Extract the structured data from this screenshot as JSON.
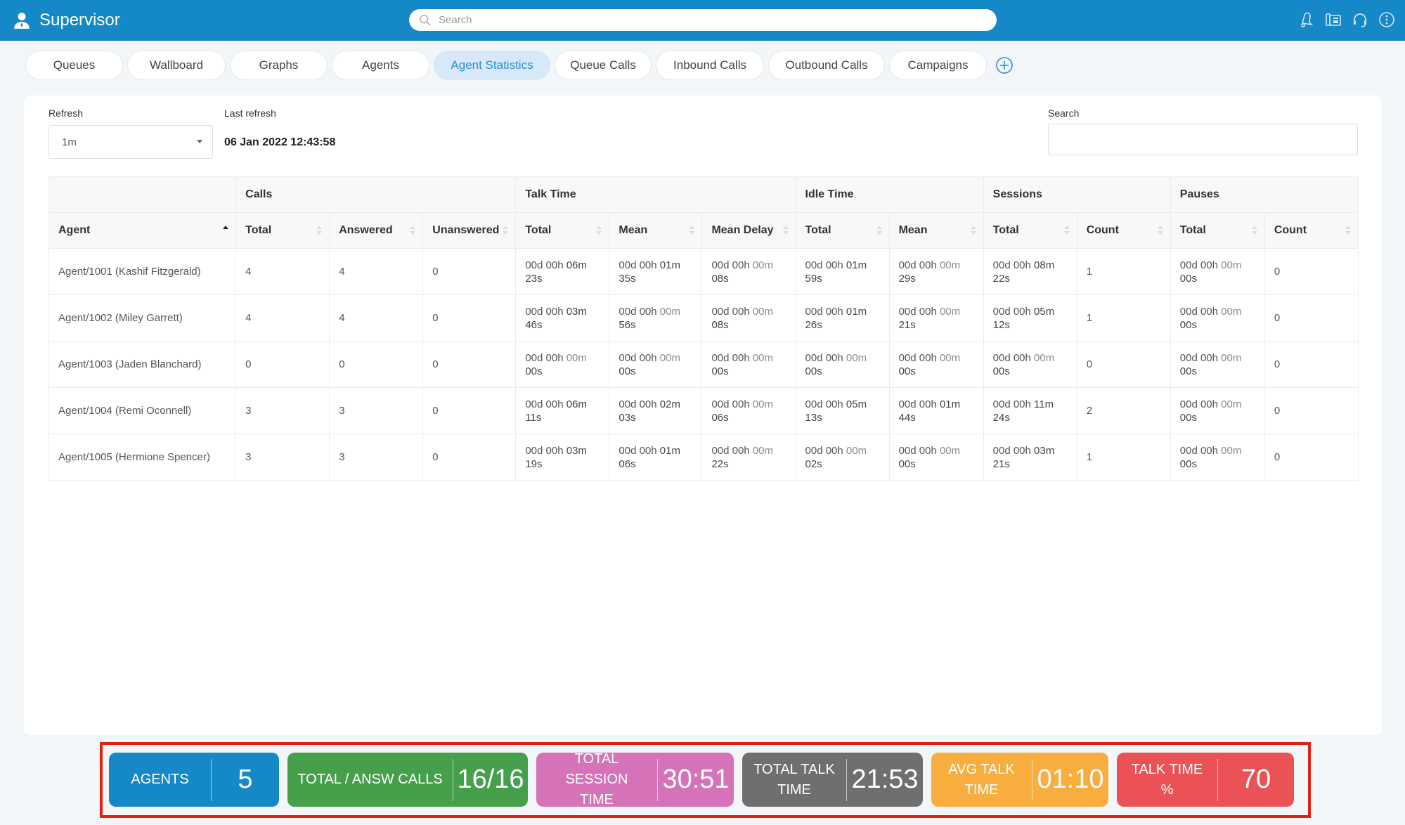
{
  "header": {
    "title": "Supervisor",
    "search_placeholder": "Search",
    "icons": [
      "bell-icon",
      "phone-icon",
      "headset-icon",
      "more-options-icon"
    ]
  },
  "tabs": [
    {
      "label": "Queues",
      "active": false
    },
    {
      "label": "Wallboard",
      "active": false
    },
    {
      "label": "Graphs",
      "active": false
    },
    {
      "label": "Agents",
      "active": false
    },
    {
      "label": "Agent Statistics",
      "active": true
    },
    {
      "label": "Queue Calls",
      "active": false
    },
    {
      "label": "Inbound Calls",
      "active": false
    },
    {
      "label": "Outbound Calls",
      "active": false
    },
    {
      "label": "Campaigns",
      "active": false
    }
  ],
  "controls": {
    "refresh_label": "Refresh",
    "refresh_value": "1m",
    "last_refresh_label": "Last refresh",
    "last_refresh_value": "06 Jan 2022 12:43:58",
    "search_label": "Search",
    "search_value": ""
  },
  "table": {
    "groups": [
      "",
      "Calls",
      "Talk Time",
      "Idle Time",
      "Sessions",
      "Pauses"
    ],
    "columns": [
      "Agent",
      "Total",
      "Answered",
      "Unanswered",
      "Total",
      "Mean",
      "Mean Delay",
      "Total",
      "Mean",
      "Total",
      "Count",
      "Total",
      "Count"
    ],
    "sorted_column": "Agent",
    "sort_direction": "ascending",
    "rows": [
      [
        "Agent/1001 (Kashif Fitzgerald)",
        "4",
        "4",
        "0",
        "00d 00h 06m 23s",
        "00d 00h 01m 35s",
        "00d 00h 00m 08s",
        "00d 00h 01m 59s",
        "00d 00h 00m 29s",
        "00d 00h 08m 22s",
        "1",
        "00d 00h 00m 00s",
        "0"
      ],
      [
        "Agent/1002 (Miley Garrett)",
        "4",
        "4",
        "0",
        "00d 00h 03m 46s",
        "00d 00h 00m 56s",
        "00d 00h 00m 08s",
        "00d 00h 01m 26s",
        "00d 00h 00m 21s",
        "00d 00h 05m 12s",
        "1",
        "00d 00h 00m 00s",
        "0"
      ],
      [
        "Agent/1003 (Jaden Blanchard)",
        "0",
        "0",
        "0",
        "00d 00h 00m 00s",
        "00d 00h 00m 00s",
        "00d 00h 00m 00s",
        "00d 00h 00m 00s",
        "00d 00h 00m 00s",
        "00d 00h 00m 00s",
        "0",
        "00d 00h 00m 00s",
        "0"
      ],
      [
        "Agent/1004 (Remi Oconnell)",
        "3",
        "3",
        "0",
        "00d 00h 06m 11s",
        "00d 00h 02m 03s",
        "00d 00h 00m 06s",
        "00d 00h 05m 13s",
        "00d 00h 01m 44s",
        "00d 00h 11m 24s",
        "2",
        "00d 00h 00m 00s",
        "0"
      ],
      [
        "Agent/1005 (Hermione Spencer)",
        "3",
        "3",
        "0",
        "00d 00h 03m 19s",
        "00d 00h 01m 06s",
        "00d 00h 00m 22s",
        "00d 00h 00m 02s",
        "00d 00h 00m 00s",
        "00d 00h 03m 21s",
        "1",
        "00d 00h 00m 00s",
        "0"
      ]
    ]
  },
  "summary": [
    {
      "label": "AGENTS",
      "value": "5",
      "color": "#1588c8"
    },
    {
      "label": "TOTAL / ANSW CALLS",
      "value": "16/16",
      "color": "#46a04b"
    },
    {
      "label": "TOTAL SESSION TIME",
      "value": "30:51",
      "color": "#d673b8"
    },
    {
      "label": "TOTAL TALK TIME",
      "value": "21:53",
      "color": "#6f6f6f"
    },
    {
      "label": "AVG TALK TIME",
      "value": "01:10",
      "color": "#f7ae3f"
    },
    {
      "label": "TALK TIME %",
      "value": "70",
      "color": "#ea5256"
    }
  ],
  "colors": {
    "header_bg": "#1588c8",
    "active_tab_bg": "#d7e9f8",
    "active_tab_text": "#2a8fd2",
    "highlight_border": "#e0220e"
  }
}
